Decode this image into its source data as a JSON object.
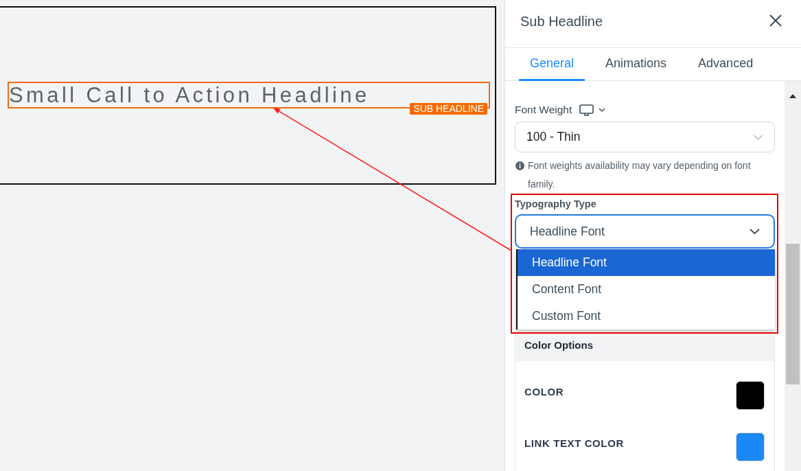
{
  "canvas": {
    "headline": {
      "text": "Small Call to Action Headline",
      "badge": "SUB HEADLINE",
      "selected": true
    }
  },
  "panel": {
    "title": "Sub Headline",
    "tabs": [
      {
        "label": "General",
        "selected": true
      },
      {
        "label": "Animations",
        "selected": false
      },
      {
        "label": "Advanced",
        "selected": false
      }
    ],
    "font_weight": {
      "label": "Font Weight",
      "value": "100 - Thin",
      "note": "Font weights availability may vary depending on font family."
    },
    "typography_type": {
      "label": "Typography Type",
      "value": "Headline Font",
      "expanded": true,
      "options": [
        {
          "label": "Headline Font",
          "selected": true
        },
        {
          "label": "Content Font",
          "selected": false
        },
        {
          "label": "Custom Font",
          "selected": false
        }
      ]
    },
    "color_options": {
      "title": "Color Options",
      "rows": [
        {
          "label": "COLOR",
          "color": "#000000"
        },
        {
          "label": "LINK TEXT COLOR",
          "color": "#1a88f5"
        }
      ]
    }
  }
}
